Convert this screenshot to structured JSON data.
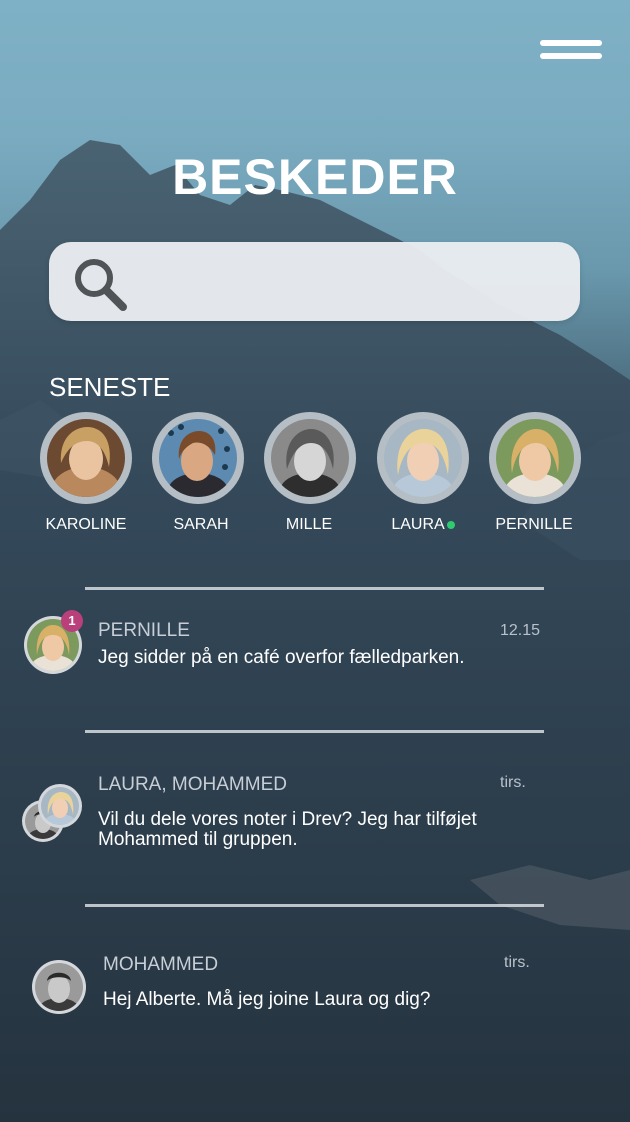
{
  "header": {
    "title": "BESKEDER",
    "menu_icon": "hamburger-menu-icon"
  },
  "search": {
    "placeholder": "",
    "icon": "search-icon"
  },
  "recent": {
    "label": "SENESTE",
    "contacts": [
      {
        "name": "KAROLINE",
        "online": false
      },
      {
        "name": "SARAH",
        "online": false
      },
      {
        "name": "MILLE",
        "online": false
      },
      {
        "name": "LAURA",
        "online": true
      },
      {
        "name": "PERNILLE",
        "online": false
      }
    ]
  },
  "conversations": [
    {
      "name": "PERNILLE",
      "time": "12.15",
      "message": "Jeg sidder på en café overfor fælledparken.",
      "unread": "1"
    },
    {
      "name": "LAURA, MOHAMMED",
      "time": "tirs.",
      "message": "Vil du dele vores noter i Drev? Jeg har tilføjet Mohammed til gruppen."
    },
    {
      "name": "MOHAMMED",
      "time": "tirs.",
      "message": "Hej Alberte. Må jeg joine Laura og dig?"
    }
  ],
  "colors": {
    "online": "#2ecc71",
    "badge": "#b9407a",
    "sky": "#7fb1c6",
    "mountain": "#2f4554"
  }
}
